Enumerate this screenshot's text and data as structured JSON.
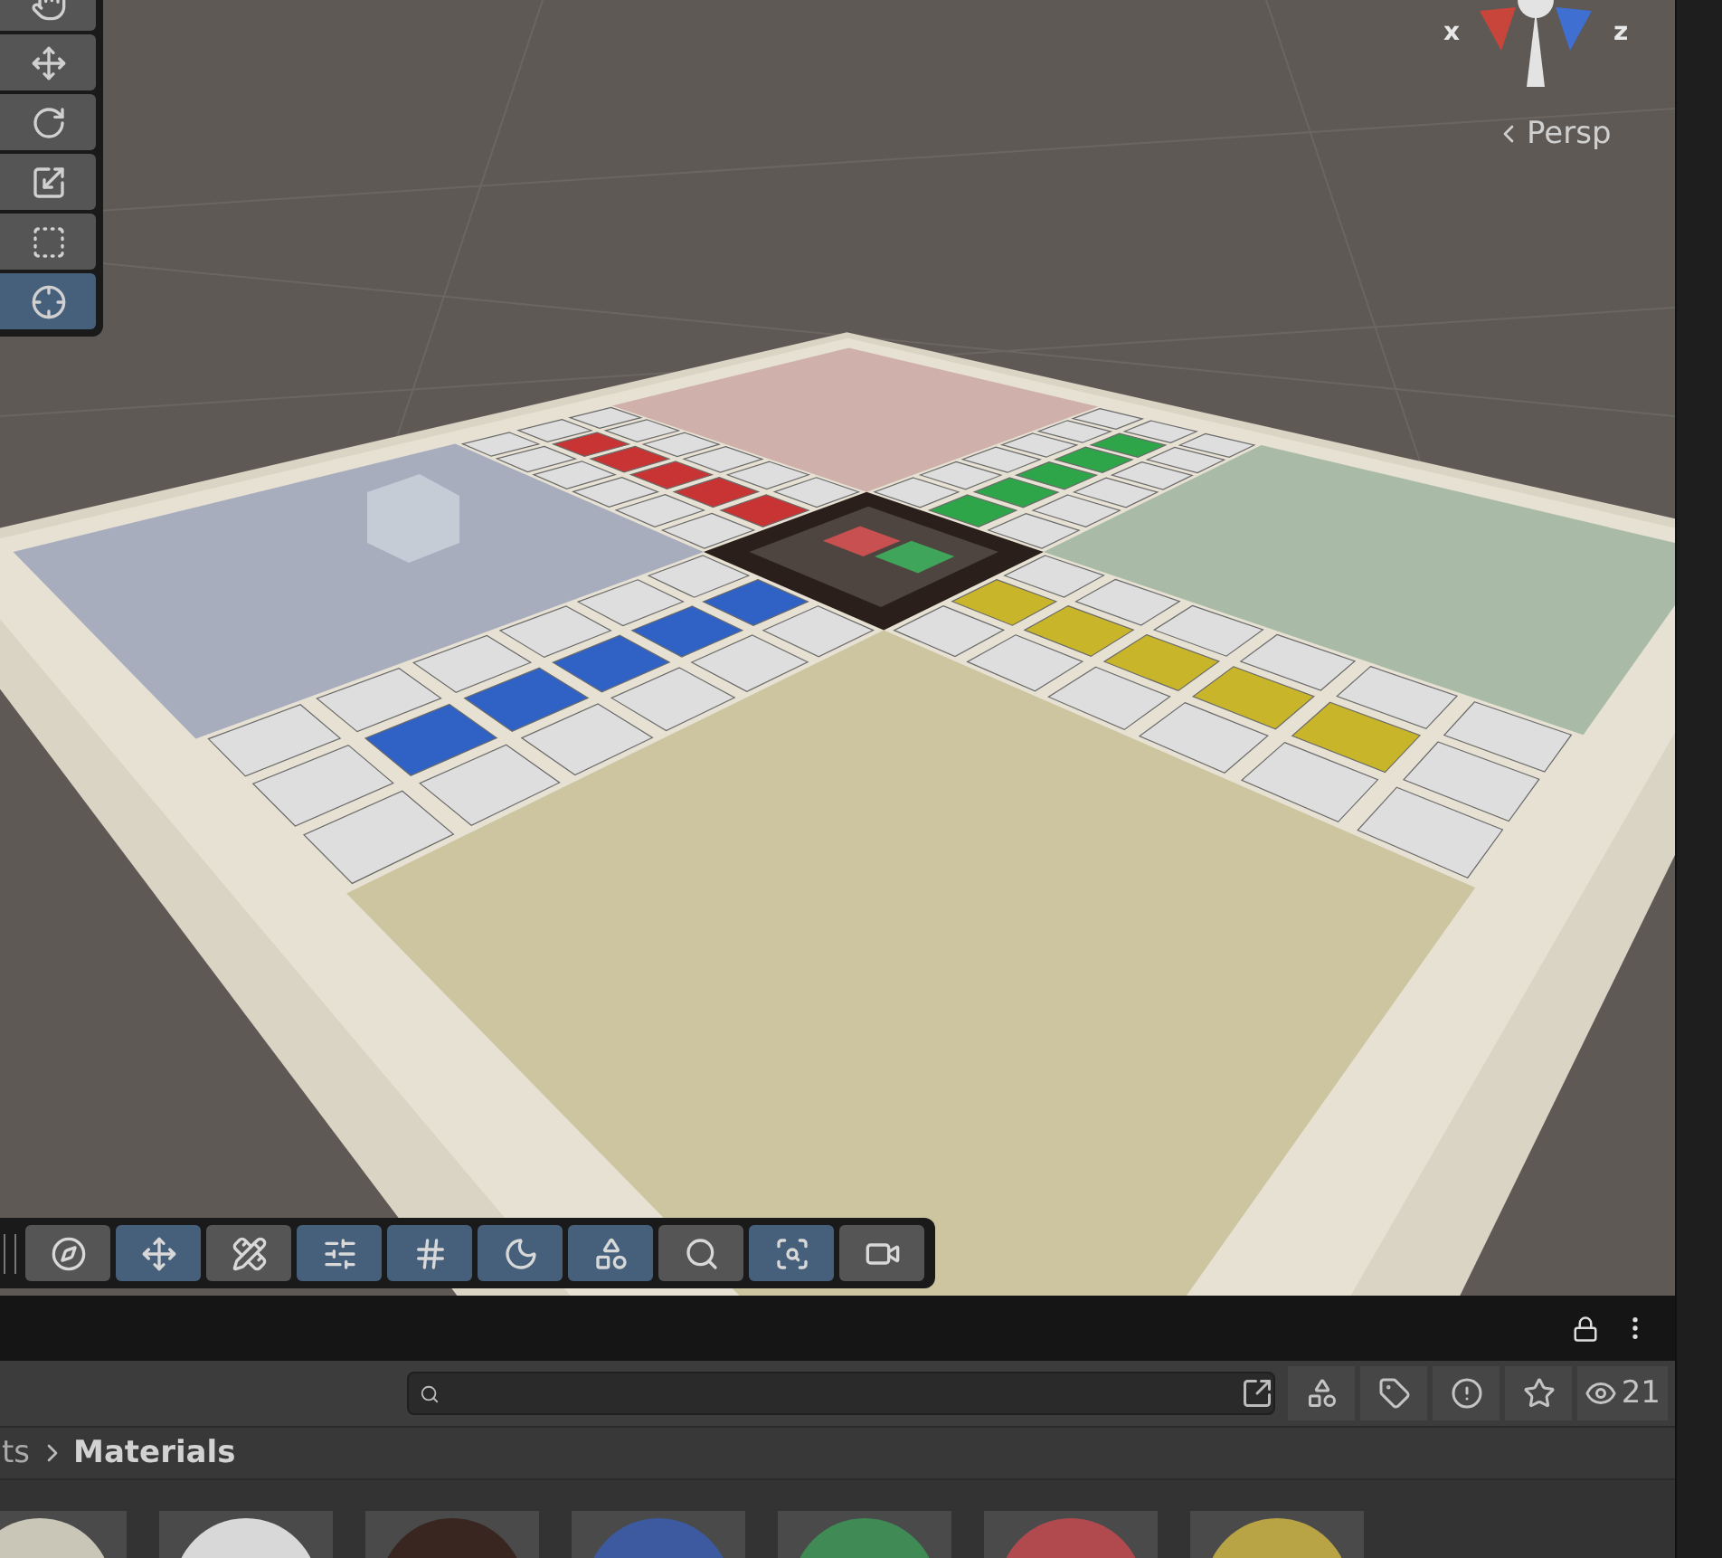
{
  "scene_view": {
    "tools": [
      {
        "kind": "hand",
        "selected": false
      },
      {
        "kind": "move",
        "selected": false
      },
      {
        "kind": "rotate",
        "selected": false
      },
      {
        "kind": "scale",
        "selected": false
      },
      {
        "kind": "rect",
        "selected": false
      },
      {
        "kind": "transform",
        "selected": true
      }
    ],
    "gizmo": {
      "x_label": "x",
      "z_label": "z",
      "view_label": "Persp"
    },
    "overlay_toolbar": [
      {
        "kind": "orientation",
        "on": false
      },
      {
        "kind": "move",
        "on": true
      },
      {
        "kind": "tool-settings",
        "on": false
      },
      {
        "kind": "sliders",
        "on": true
      },
      {
        "kind": "grid-snap",
        "on": true
      },
      {
        "kind": "lighting",
        "on": true
      },
      {
        "kind": "visibility",
        "on": true
      },
      {
        "kind": "search",
        "on": false
      },
      {
        "kind": "gizmos",
        "on": true
      },
      {
        "kind": "camera",
        "on": false
      }
    ]
  },
  "project_panel": {
    "filters": [
      {
        "kind": "type"
      },
      {
        "kind": "label"
      },
      {
        "kind": "warning"
      },
      {
        "kind": "favorite"
      },
      {
        "kind": "hidden-count",
        "count": "21"
      }
    ],
    "breadcrumb": [
      "ts",
      "Materials"
    ],
    "materials": [
      {
        "color": "#c9c6b8"
      },
      {
        "color": "#d8d8d8"
      },
      {
        "color": "#3a2620"
      },
      {
        "color": "#3d5aa0"
      },
      {
        "color": "#3f8a55"
      },
      {
        "color": "#b04a4e"
      },
      {
        "color": "#b8a445"
      }
    ]
  }
}
